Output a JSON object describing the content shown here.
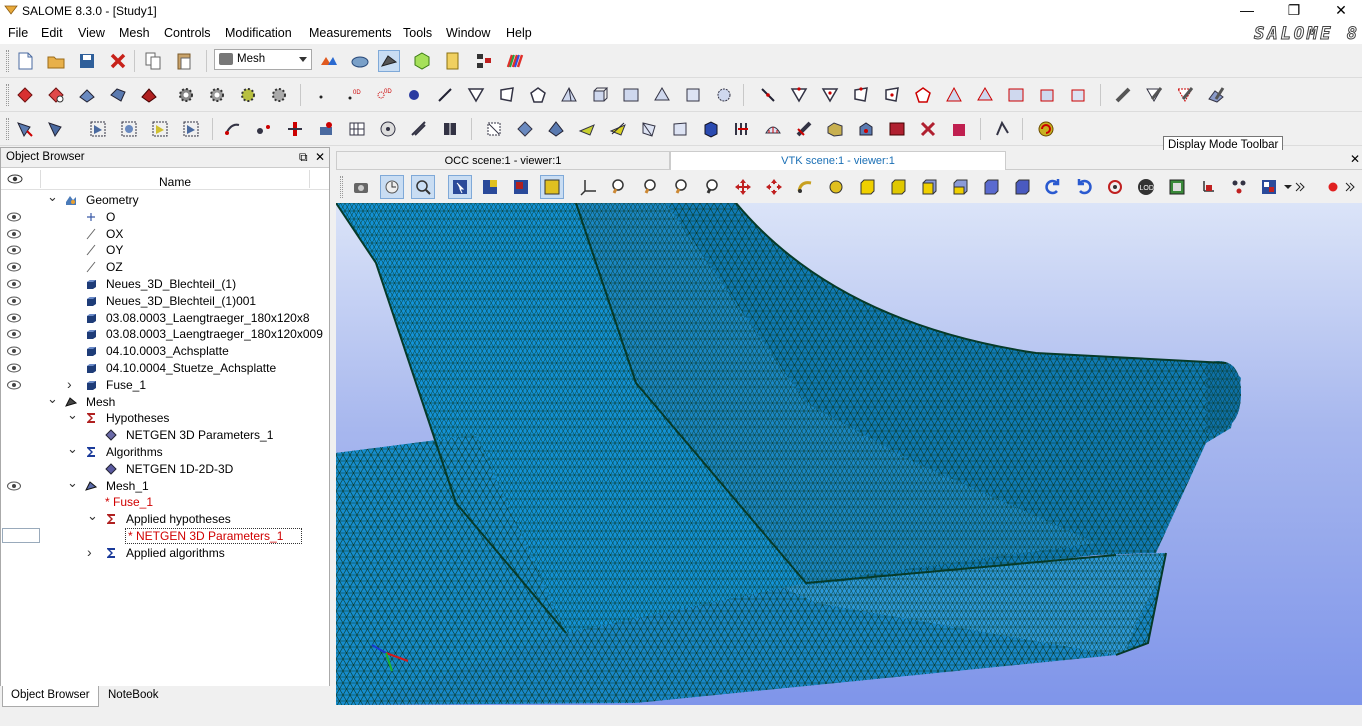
{
  "window": {
    "title": "SALOME 8.3.0 - [Study1]",
    "brand": "SALOME 8",
    "minimize": "—",
    "maximize": "❐",
    "close": "✕"
  },
  "menu": [
    "File",
    "Edit",
    "View",
    "Mesh",
    "Controls",
    "Modification",
    "Measurements",
    "Tools",
    "Window",
    "Help"
  ],
  "module_combo": {
    "value": "Mesh"
  },
  "tooltip": "Display Mode Toolbar",
  "object_browser": {
    "title": "Object Browser",
    "column_name": "Name",
    "tree": [
      {
        "label": "Geometry",
        "level": 0,
        "expander": "open",
        "eye": false,
        "icon": "geometry-icon"
      },
      {
        "label": "O",
        "level": 1,
        "eye": true,
        "icon": "point-icon"
      },
      {
        "label": "OX",
        "level": 1,
        "eye": true,
        "icon": "axis-icon"
      },
      {
        "label": "OY",
        "level": 1,
        "eye": true,
        "icon": "axis-icon"
      },
      {
        "label": "OZ",
        "level": 1,
        "eye": true,
        "icon": "axis-icon"
      },
      {
        "label": "Neues_3D_Blechteil_(1)",
        "level": 1,
        "eye": true,
        "icon": "solid-icon"
      },
      {
        "label": "Neues_3D_Blechteil_(1)001",
        "level": 1,
        "eye": true,
        "icon": "solid-icon"
      },
      {
        "label": "03.08.0003_Laengtraeger_180x120x8",
        "level": 1,
        "eye": true,
        "icon": "solid-icon"
      },
      {
        "label": "03.08.0003_Laengtraeger_180x120x009",
        "level": 1,
        "eye": true,
        "icon": "solid-icon"
      },
      {
        "label": "04.10.0003_Achsplatte",
        "level": 1,
        "eye": true,
        "icon": "solid-icon"
      },
      {
        "label": "04.10.0004_Stuetze_Achsplatte",
        "level": 1,
        "eye": true,
        "icon": "solid-icon"
      },
      {
        "label": "Fuse_1",
        "level": 1,
        "expander": "closed",
        "eye": true,
        "icon": "solid-icon"
      },
      {
        "label": "Mesh",
        "level": 0,
        "expander": "open",
        "eye": false,
        "icon": "mesh-module-icon"
      },
      {
        "label": "Hypotheses",
        "level": 1,
        "expander": "open",
        "eye": false,
        "icon": "hypotheses-icon"
      },
      {
        "label": "NETGEN 3D Parameters_1",
        "level": 2,
        "eye": false,
        "icon": "hypothesis-icon"
      },
      {
        "label": "Algorithms",
        "level": 1,
        "expander": "open",
        "eye": false,
        "icon": "algorithms-icon"
      },
      {
        "label": "NETGEN 1D-2D-3D",
        "level": 2,
        "eye": false,
        "icon": "algorithm-icon"
      },
      {
        "label": "Mesh_1",
        "level": 1,
        "expander": "open",
        "eye": true,
        "icon": "mesh-icon"
      },
      {
        "label": "* Fuse_1",
        "level": 2,
        "eye": false,
        "icon": "",
        "red": true
      },
      {
        "label": "Applied hypotheses",
        "level": 2,
        "expander": "open",
        "eye": false,
        "icon": "hypotheses-icon"
      },
      {
        "label": "* NETGEN 3D Parameters_1",
        "level": 3,
        "eye": false,
        "icon": "",
        "red": true,
        "selected": true
      },
      {
        "label": "Applied algorithms",
        "level": 2,
        "expander": "closed",
        "eye": false,
        "icon": "algorithms-icon"
      }
    ],
    "tabs": [
      "Object Browser",
      "NoteBook"
    ]
  },
  "viewer_tabs": [
    "OCC scene:1 - viewer:1",
    "VTK scene:1 - viewer:1"
  ]
}
